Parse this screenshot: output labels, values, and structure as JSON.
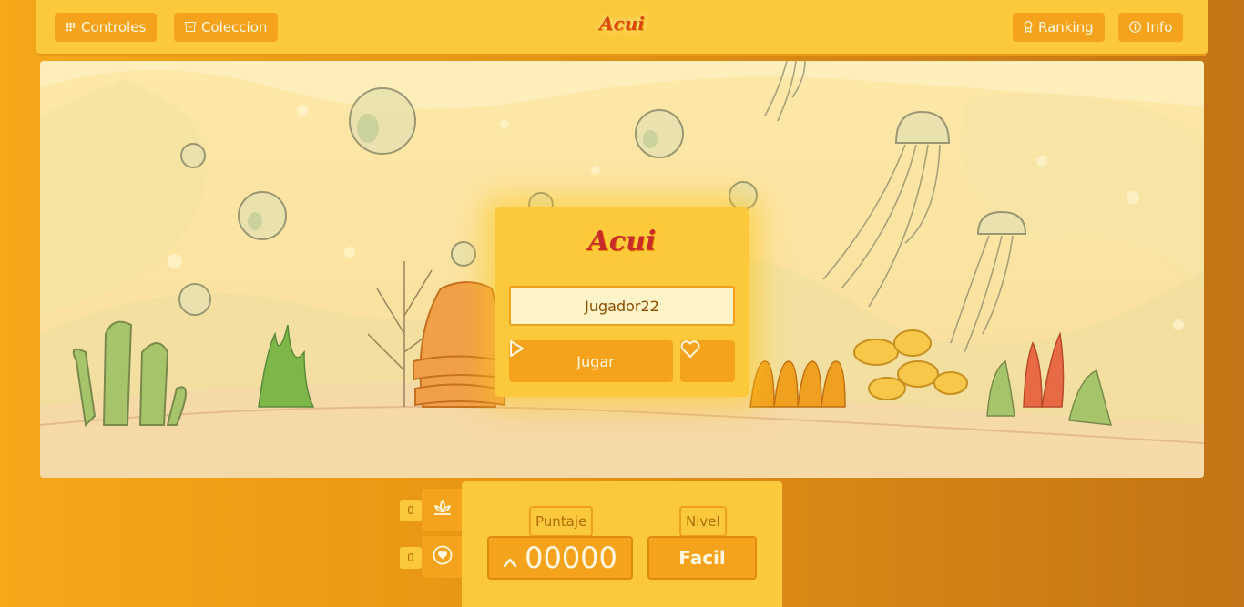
{
  "nav": {
    "controls_label": "Controles",
    "collection_label": "Coleccion",
    "ranking_label": "Ranking",
    "info_label": "Info"
  },
  "app": {
    "logo": "Acui"
  },
  "start_dialog": {
    "logo": "Acui",
    "player_name_value": "Jugador22",
    "play_label": "Jugar"
  },
  "hud": {
    "lotus_count": "0",
    "heart_count": "0",
    "score_label": "Puntaje",
    "score_value": "00000",
    "level_label": "Nivel",
    "level_value": "Facil"
  },
  "colors": {
    "background": "#e59313",
    "panel": "#fdc93c",
    "button": "#f5a31c",
    "logo_red": "#c92a2a"
  },
  "icons": [
    "grid-icon",
    "archive-icon",
    "medal-icon",
    "info-icon",
    "play-icon",
    "heart-icon",
    "lotus-icon",
    "heart-badge-icon",
    "chevron-up-icon"
  ]
}
